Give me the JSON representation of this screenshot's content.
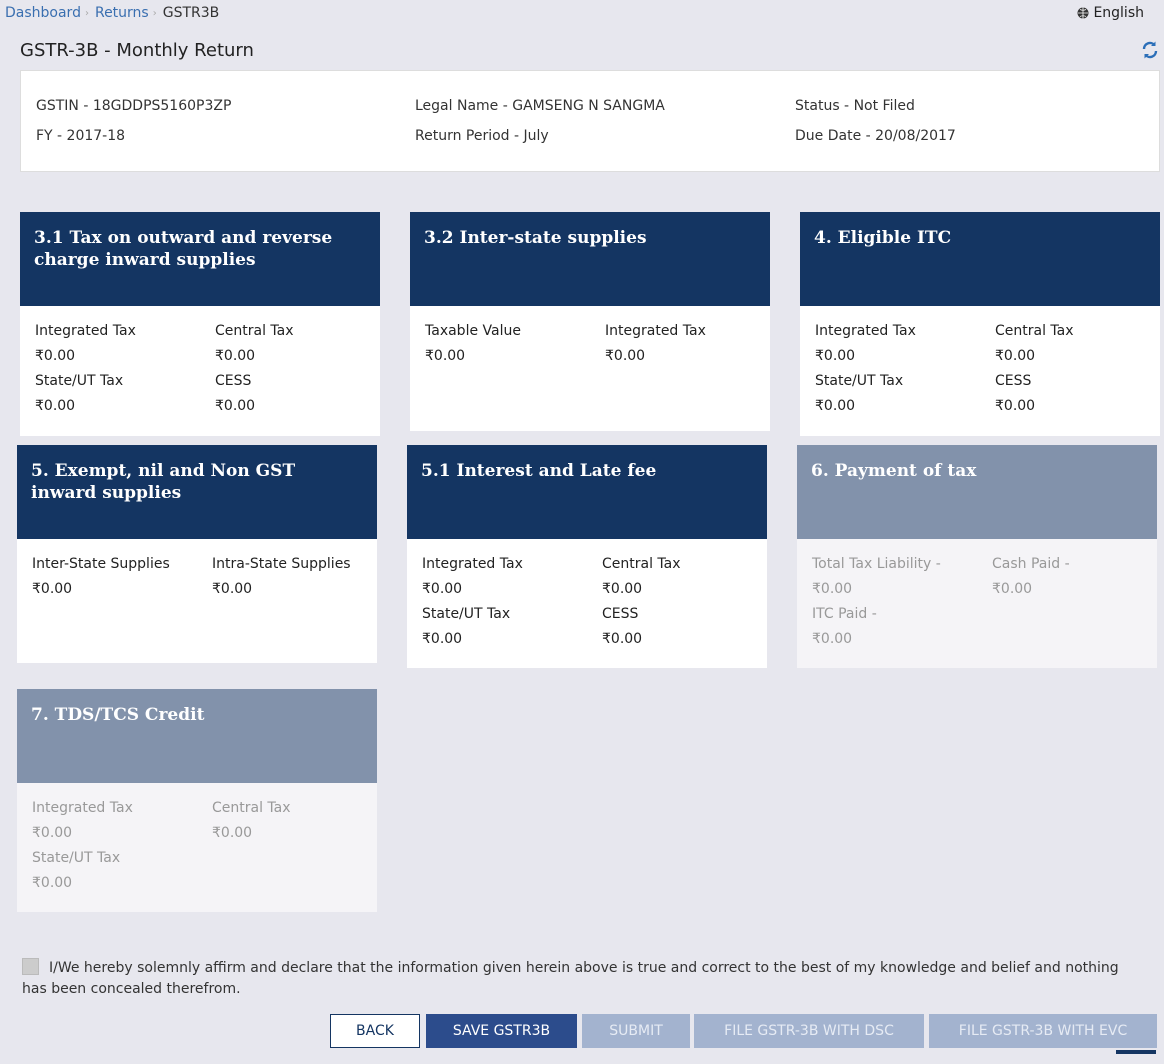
{
  "breadcrumb": {
    "items": [
      "Dashboard",
      "Returns"
    ],
    "current": "GSTR3B"
  },
  "language": "English",
  "page_title": "GSTR-3B - Monthly Return",
  "info": {
    "gstin": "GSTIN - 18GDDPS5160P3ZP",
    "legal_name": "Legal Name - GAMSENG N SANGMA",
    "status": "Status - Not Filed",
    "fy": "FY - 2017-18",
    "return_period": "Return Period - July",
    "due_date": "Due Date - 20/08/2017"
  },
  "cards": {
    "c31": {
      "title": "3.1 Tax on outward and reverse charge inward supplies",
      "l1": "Integrated Tax",
      "v1": "₹0.00",
      "l2": "Central Tax",
      "v2": "₹0.00",
      "l3": "State/UT Tax",
      "v3": "₹0.00",
      "l4": "CESS",
      "v4": "₹0.00"
    },
    "c32": {
      "title": "3.2 Inter-state supplies",
      "l1": "Taxable Value",
      "v1": "₹0.00",
      "l2": "Integrated Tax",
      "v2": "₹0.00"
    },
    "c4": {
      "title": "4. Eligible ITC",
      "l1": "Integrated Tax",
      "v1": "₹0.00",
      "l2": "Central Tax",
      "v2": "₹0.00",
      "l3": "State/UT Tax",
      "v3": "₹0.00",
      "l4": "CESS",
      "v4": "₹0.00"
    },
    "c5": {
      "title": "5. Exempt, nil and Non GST inward supplies",
      "l1": "Inter-State Supplies",
      "v1": "₹0.00",
      "l2": "Intra-State Supplies",
      "v2": "₹0.00"
    },
    "c51": {
      "title": "5.1 Interest and Late fee",
      "l1": "Integrated Tax",
      "v1": "₹0.00",
      "l2": "Central Tax",
      "v2": "₹0.00",
      "l3": "State/UT Tax",
      "v3": "₹0.00",
      "l4": "CESS",
      "v4": "₹0.00"
    },
    "c6": {
      "title": "6. Payment of tax",
      "l1": "Total Tax Liability -",
      "v1": "₹0.00",
      "l2": "Cash Paid -",
      "v2": "₹0.00",
      "l3": "ITC Paid -",
      "v3": "₹0.00"
    },
    "c7": {
      "title": "7. TDS/TCS Credit",
      "l1": "Integrated Tax",
      "v1": "₹0.00",
      "l2": "Central Tax",
      "v2": "₹0.00",
      "l3": "State/UT Tax",
      "v3": "₹0.00"
    }
  },
  "declaration": "I/We hereby solemnly affirm and declare that the information given herein above is true and correct to the best of my knowledge and belief and nothing has been concealed therefrom.",
  "buttons": {
    "back": "BACK",
    "save": "SAVE GSTR3B",
    "submit": "SUBMIT",
    "file_dsc": "FILE GSTR-3B WITH DSC",
    "file_evc": "FILE GSTR-3B WITH EVC"
  },
  "colors": {
    "card_header": "#143562",
    "card_header_disabled": "#8292ab",
    "primary_button": "#2c4c8c"
  }
}
